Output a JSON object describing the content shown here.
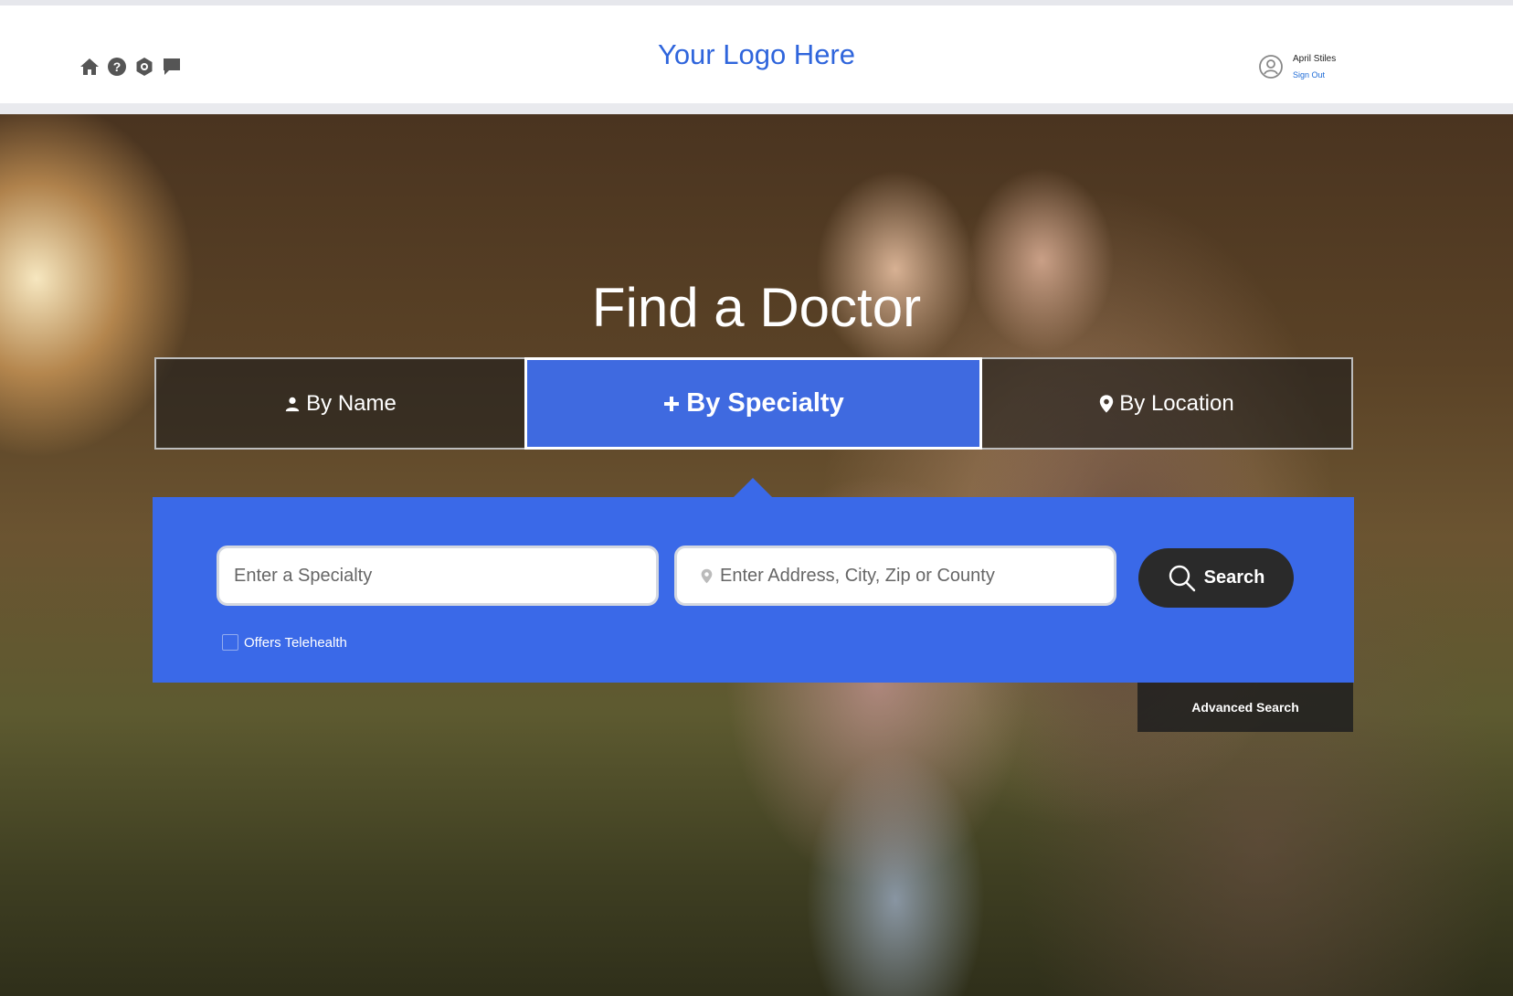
{
  "header": {
    "logo_text": "Your Logo Here",
    "icons": [
      "home-icon",
      "help-icon",
      "settings-icon",
      "chat-icon"
    ],
    "user": {
      "name": "April Stiles",
      "sign_out": "Sign Out"
    }
  },
  "hero": {
    "title": "Find a Doctor"
  },
  "tabs": {
    "by_name": "By Name",
    "by_specialty": "By Specialty",
    "by_location": "By Location",
    "active": "by_specialty"
  },
  "search_panel": {
    "specialty_placeholder": "Enter a Specialty",
    "address_placeholder": "Enter Address, City, Zip or County",
    "search_label": "Search",
    "telehealth_label": "Offers Telehealth"
  },
  "advanced_search_label": "Advanced Search",
  "colors": {
    "accent_blue": "#3a69e8",
    "active_tab": "#3f6ae0",
    "logo_blue": "#2f65dc",
    "dark_button": "#2a2a2a"
  }
}
